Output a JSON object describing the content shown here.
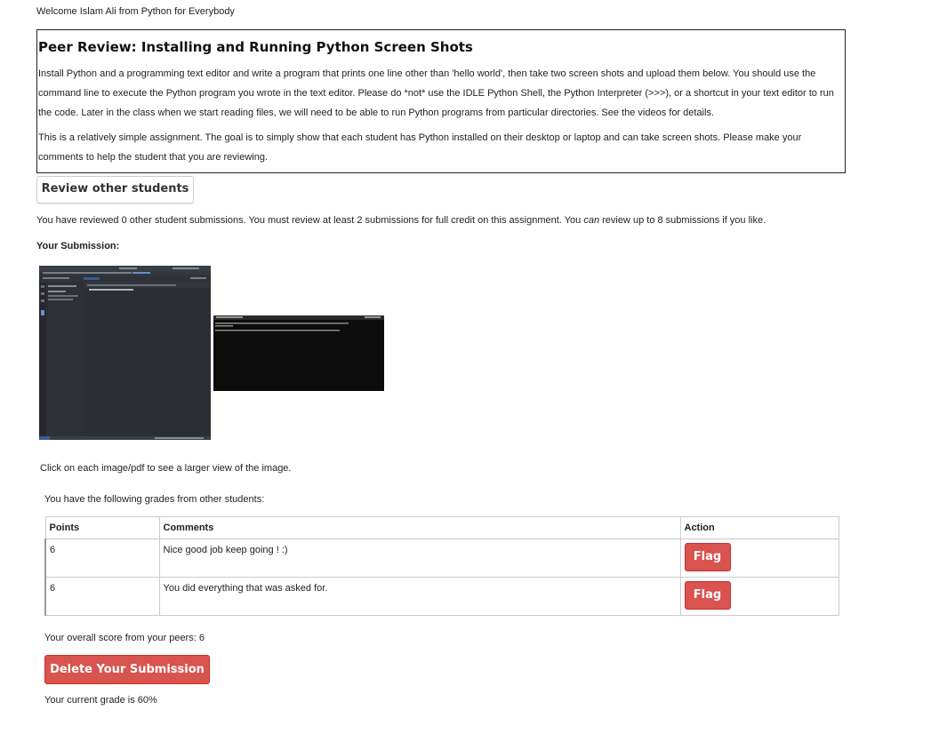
{
  "welcome": "Welcome Islam Ali from Python for Everybody",
  "assignment": {
    "title": "Peer Review: Installing and Running Python Screen Shots",
    "paragraph1": "Install Python and a programming text editor and write a program that prints one line other than 'hello world', then take two screen shots and upload them below. You should use the command line to execute the Python program you wrote in the text editor. Please do *not* use the IDLE Python Shell, the Python Interpreter (>>>), or a shortcut in your text editor to run the code. Later in the class when we start reading files, we will need to be able to run Python programs from particular directories. See the videos for details.",
    "paragraph2": "This is a relatively simple assignment. The goal is to simply show that each student has Python installed on their desktop or laptop and can take screen shots. Please make your comments to help the student that you are reviewing."
  },
  "review_button": "Review other students",
  "reviewed": {
    "before": "You have reviewed 0 other student submissions. You must review at least 2 submissions for full credit on this assignment. You ",
    "em": "can",
    "after": " review up to 8 submissions if you like."
  },
  "your_submission_label": "Your Submission:",
  "click_note": "Click on each image/pdf to see a larger view of the image.",
  "grades_note": "You have the following grades from other students:",
  "grades_table": {
    "headers": {
      "points": "Points",
      "comments": "Comments",
      "action": "Action"
    },
    "rows": [
      {
        "points": "6",
        "comment": "Nice good job keep going ! :)",
        "action": "Flag"
      },
      {
        "points": "6",
        "comment": "You did everything that was asked for.",
        "action": "Flag"
      }
    ]
  },
  "overall_score": "Your overall score from your peers: 6",
  "delete_button": "Delete Your Submission",
  "current_grade": "Your current grade is 60%",
  "colors": {
    "danger": "#d9534f",
    "editor_bg": "#2b2e35",
    "terminal_bg": "#0c0c0c"
  }
}
